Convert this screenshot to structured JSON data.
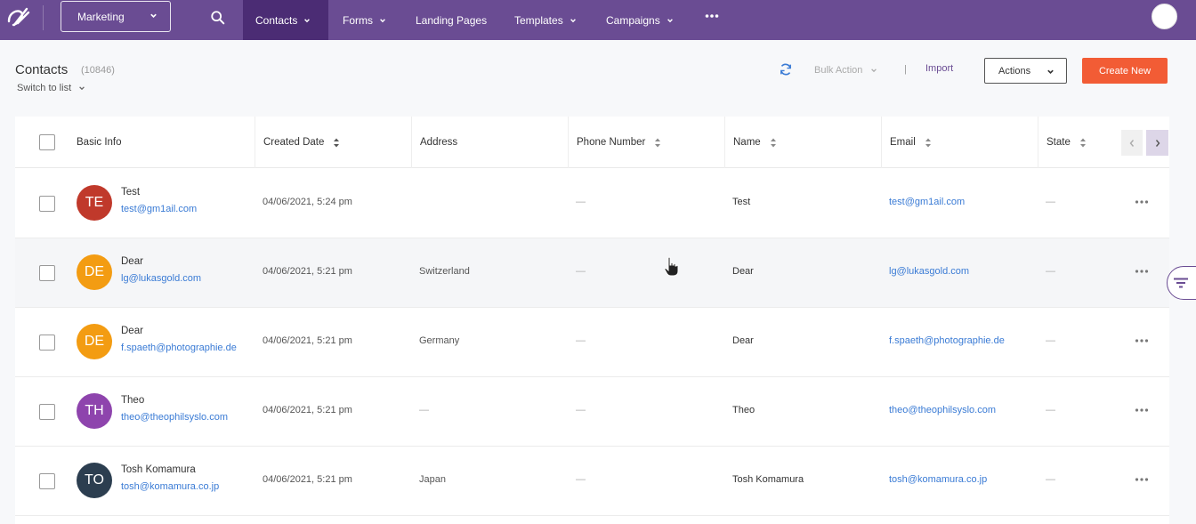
{
  "nav": {
    "workspace": "Marketing",
    "items": [
      {
        "label": "Contacts",
        "chevron": true
      },
      {
        "label": "Forms",
        "chevron": true
      },
      {
        "label": "Landing Pages",
        "chevron": false
      },
      {
        "label": "Templates",
        "chevron": true
      },
      {
        "label": "Campaigns",
        "chevron": true
      }
    ],
    "active_item": "Contacts",
    "colors": {
      "bar": "#6a4c93",
      "active": "#4b2c74"
    }
  },
  "header": {
    "title": "Contacts",
    "count": "(10846)",
    "switch_list": "Switch to list",
    "bulk_action": "Bulk Action",
    "separator": "|",
    "import": "Import",
    "actions": "Actions",
    "create_new": "Create New"
  },
  "table": {
    "columns": [
      {
        "label": "Basic Info",
        "sortable": false
      },
      {
        "label": "Created Date",
        "sortable": true
      },
      {
        "label": "Address",
        "sortable": false
      },
      {
        "label": "Phone Number",
        "sortable": true
      },
      {
        "label": "Name",
        "sortable": true
      },
      {
        "label": "Email",
        "sortable": true
      },
      {
        "label": "State",
        "sortable": true
      }
    ],
    "rows": [
      {
        "initials": "TE",
        "avatar_color": "#c0392b",
        "name": "Test",
        "email": "test@gm1ail.com",
        "created": "04/06/2021, 5:24 pm",
        "address": "",
        "phone": "—",
        "full_name": "Test",
        "email_col": "test@gm1ail.com",
        "state": "—"
      },
      {
        "initials": "DE",
        "avatar_color": "#f39c12",
        "name": "Dear",
        "email": "lg@lukasgold.com",
        "created": "04/06/2021, 5:21 pm",
        "address": "Switzerland",
        "phone": "—",
        "full_name": "Dear",
        "email_col": "lg@lukasgold.com",
        "state": "—"
      },
      {
        "initials": "DE",
        "avatar_color": "#f39c12",
        "name": "Dear",
        "email": "f.spaeth@photographie.de",
        "created": "04/06/2021, 5:21 pm",
        "address": "Germany",
        "phone": "—",
        "full_name": "Dear",
        "email_col": "f.spaeth@photographie.de",
        "state": "—"
      },
      {
        "initials": "TH",
        "avatar_color": "#8e44ad",
        "name": "Theo",
        "email": "theo@theophilsyslo.com",
        "created": "04/06/2021, 5:21 pm",
        "address": "—",
        "phone": "—",
        "full_name": "Theo",
        "email_col": "theo@theophilsyslo.com",
        "state": "—"
      },
      {
        "initials": "TO",
        "avatar_color": "#2c3e50",
        "name": "Tosh Komamura",
        "email": "tosh@komamura.co.jp",
        "created": "04/06/2021, 5:21 pm",
        "address": "Japan",
        "phone": "—",
        "full_name": "Tosh Komamura",
        "email_col": "tosh@komamura.co.jp",
        "state": "—"
      }
    ]
  },
  "colors": {
    "accent": "#6a4c93",
    "create": "#f25c35",
    "link": "#3a7bd5"
  }
}
